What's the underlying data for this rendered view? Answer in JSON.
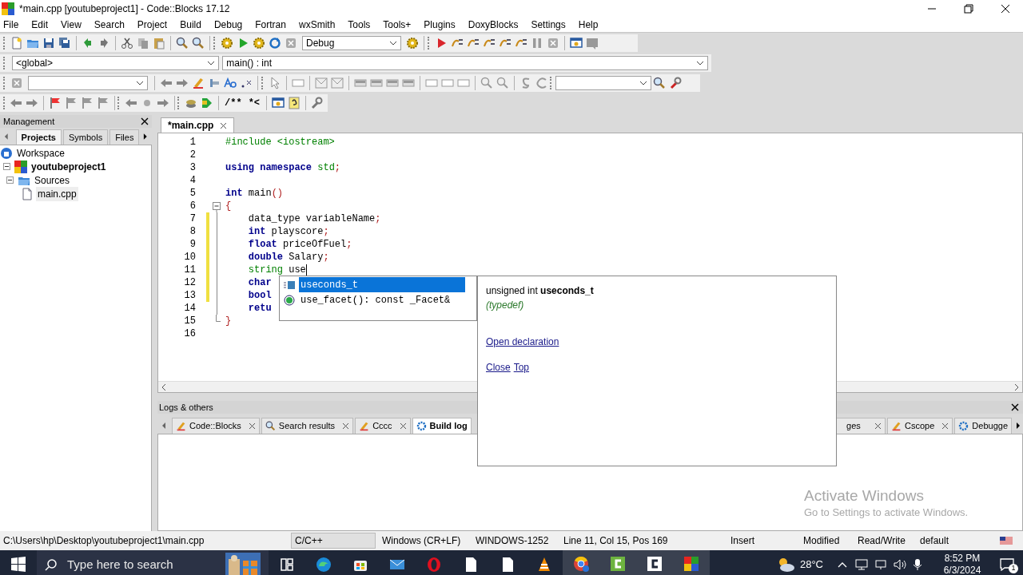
{
  "window": {
    "title": "*main.cpp [youtubeproject1] - Code::Blocks 17.12"
  },
  "menu": [
    "File",
    "Edit",
    "View",
    "Search",
    "Project",
    "Build",
    "Debug",
    "Fortran",
    "wxSmith",
    "Tools",
    "Tools+",
    "Plugins",
    "DoxyBlocks",
    "Settings",
    "Help"
  ],
  "toolbar": {
    "build_target": "Debug",
    "scope": "<global>",
    "function": "main() : int",
    "comment_block": "/**",
    "comment_line": "*<"
  },
  "management": {
    "title": "Management",
    "tabs": [
      {
        "label": "Projects",
        "selected": true
      },
      {
        "label": "Symbols",
        "selected": false
      },
      {
        "label": "Files",
        "selected": false
      }
    ],
    "tree": [
      {
        "label": "Workspace",
        "kind": "workspace",
        "selected": false,
        "children": [
          {
            "label": "youtubeproject1",
            "kind": "project",
            "selected": false,
            "children": [
              {
                "label": "Sources",
                "kind": "folder",
                "selected": false,
                "children": [
                  {
                    "label": "main.cpp",
                    "kind": "file",
                    "selected": true
                  }
                ]
              }
            ]
          }
        ]
      }
    ]
  },
  "editor": {
    "tab": "*main.cpp",
    "lines": [
      {
        "number": "1",
        "changed": false,
        "kind": "plain",
        "tokens": [
          {
            "kind": "preproc",
            "text": "#include <iostream>"
          }
        ]
      },
      {
        "number": "2",
        "changed": false,
        "kind": "plain"
      },
      {
        "number": "3",
        "changed": false,
        "kind": "plain",
        "tokens": [
          {
            "kind": "keyword",
            "text": "using namespace"
          },
          {
            "kind": "type",
            "text": " std"
          },
          {
            "kind": "punct",
            "text": ";"
          }
        ]
      },
      {
        "number": "4",
        "changed": false,
        "kind": "plain"
      },
      {
        "number": "5",
        "changed": false,
        "kind": "plain",
        "tokens": [
          {
            "kind": "keyword",
            "text": "int"
          },
          {
            "kind": "plain",
            "text": " main"
          },
          {
            "kind": "punct",
            "text": "()"
          }
        ]
      },
      {
        "number": "6",
        "changed": false,
        "kind": "fold_start",
        "tokens": [
          {
            "kind": "punct",
            "text": "{"
          }
        ]
      },
      {
        "number": "7",
        "changed": true,
        "kind": "fold_body",
        "tokens": [
          {
            "kind": "plain",
            "text": "    data_type variableName"
          },
          {
            "kind": "punct",
            "text": ";"
          }
        ]
      },
      {
        "number": "8",
        "changed": true,
        "kind": "fold_body",
        "tokens": [
          {
            "kind": "keyword",
            "text": "    int"
          },
          {
            "kind": "plain",
            "text": " playscore"
          },
          {
            "kind": "punct",
            "text": ";"
          }
        ]
      },
      {
        "number": "9",
        "changed": true,
        "kind": "fold_body",
        "tokens": [
          {
            "kind": "keyword",
            "text": "    float"
          },
          {
            "kind": "plain",
            "text": " priceOfFuel"
          },
          {
            "kind": "punct",
            "text": ";"
          }
        ]
      },
      {
        "number": "10",
        "changed": true,
        "kind": "fold_body",
        "tokens": [
          {
            "kind": "keyword",
            "text": "    double"
          },
          {
            "kind": "plain",
            "text": " Salary"
          },
          {
            "kind": "punct",
            "text": ";"
          }
        ]
      },
      {
        "number": "11",
        "changed": true,
        "kind": "fold_body",
        "caret": true,
        "tokens": [
          {
            "kind": "type",
            "text": "    string"
          },
          {
            "kind": "plain",
            "text": " use"
          }
        ]
      },
      {
        "number": "12",
        "changed": true,
        "kind": "fold_body",
        "tokens": [
          {
            "kind": "keyword",
            "text": "    char"
          }
        ]
      },
      {
        "number": "13",
        "changed": true,
        "kind": "fold_body",
        "tokens": [
          {
            "kind": "keyword",
            "text": "    bool"
          }
        ]
      },
      {
        "number": "14",
        "changed": false,
        "kind": "fold_body",
        "tokens": [
          {
            "kind": "keyword",
            "text": "    retu"
          }
        ]
      },
      {
        "number": "15",
        "changed": false,
        "kind": "fold_end",
        "tokens": [
          {
            "kind": "punct",
            "text": "}"
          }
        ]
      },
      {
        "number": "16",
        "changed": false,
        "kind": "plain"
      }
    ]
  },
  "autocomplete": [
    {
      "kind": "typedef",
      "text": "useconds_t",
      "selected": true
    },
    {
      "kind": "function",
      "text": "use_facet(): const _Facet&",
      "selected": false
    }
  ],
  "doc_popup": {
    "signature": "unsigned int **useconds_t**",
    "category": "(typedef)",
    "open_link": "Open declaration",
    "links": [
      "Close",
      "Top"
    ]
  },
  "logs": {
    "title": "Logs & others",
    "tabs_left": [
      {
        "label": "Code::Blocks",
        "kind": "note",
        "selected": false,
        "closable": true
      },
      {
        "label": "Search results",
        "kind": "search",
        "selected": false,
        "closable": true
      },
      {
        "label": "Cccc",
        "kind": "note",
        "selected": false,
        "closable": true
      },
      {
        "label": "Build log",
        "kind": "gear",
        "selected": true,
        "closable": false
      }
    ],
    "tabs_right": [
      {
        "label": "ges",
        "kind": "none",
        "selected": false,
        "closable": true
      },
      {
        "label": "Cscope",
        "kind": "note",
        "selected": false,
        "closable": true
      },
      {
        "label": "Debugge",
        "kind": "gear",
        "selected": false,
        "closable": false
      }
    ]
  },
  "watermark": {
    "title": "Activate Windows",
    "subtitle": "Go to Settings to activate Windows."
  },
  "status_bar": {
    "path": "C:\\Users\\hp\\Desktop\\youtubeproject1\\main.cpp",
    "language": "C/C++",
    "eol": "Windows (CR+LF)",
    "encoding": "WINDOWS-1252",
    "position": "Line 11, Col 15, Pos 169",
    "mode": "Insert",
    "modified": "Modified",
    "access": "Read/Write",
    "theme": "default"
  },
  "taskbar": {
    "search_placeholder": "Type here to search",
    "temperature": "28°C",
    "time": "8:52 PM",
    "date": "6/3/2024",
    "notifications": "1"
  }
}
